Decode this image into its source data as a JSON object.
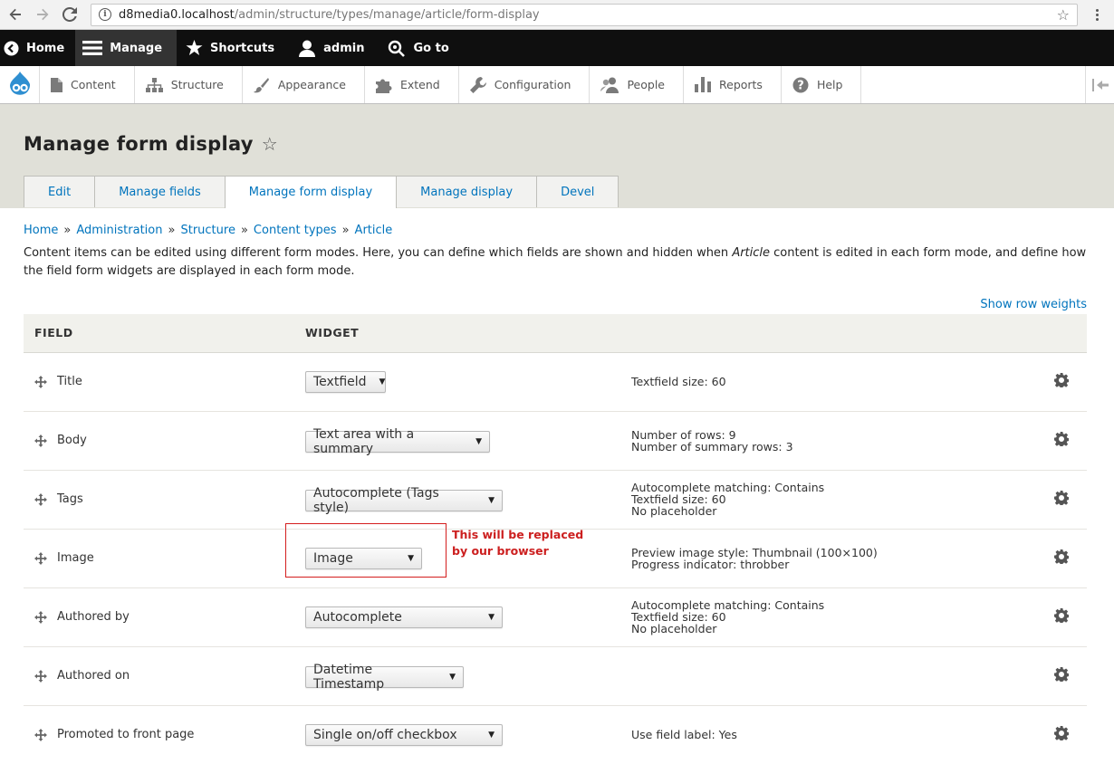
{
  "browser": {
    "url_host": "d8media0.localhost",
    "url_path": "/admin/structure/types/manage/article/form-display"
  },
  "toolbar": {
    "home": "Home",
    "manage": "Manage",
    "shortcuts": "Shortcuts",
    "user": "admin",
    "goto": "Go to"
  },
  "tray": {
    "items": [
      "Content",
      "Structure",
      "Appearance",
      "Extend",
      "Configuration",
      "People",
      "Reports",
      "Help"
    ]
  },
  "page": {
    "title": "Manage form display",
    "tabs": [
      "Edit",
      "Manage fields",
      "Manage form display",
      "Manage display",
      "Devel"
    ],
    "active_tab": "Manage form display"
  },
  "breadcrumb": [
    "Home",
    "Administration",
    "Structure",
    "Content types",
    "Article"
  ],
  "description": {
    "part1": "Content items can be edited using different form modes. Here, you can define which fields are shown and hidden when ",
    "emphasis": "Article",
    "part2": " content is edited in each form mode, and define how the field form widgets are displayed in each form mode."
  },
  "row_weights_link": "Show row weights",
  "table": {
    "headers": {
      "field": "FIELD",
      "widget": "WIDGET"
    },
    "rows": [
      {
        "field": "Title",
        "widget": "Textfield",
        "summary": [
          "Textfield size: 60"
        ]
      },
      {
        "field": "Body",
        "widget": "Text area with a summary",
        "summary": [
          "Number of rows: 9",
          "Number of summary rows: 3"
        ]
      },
      {
        "field": "Tags",
        "widget": "Autocomplete (Tags style)",
        "summary": [
          "Autocomplete matching: Contains",
          "Textfield size: 60",
          "No placeholder"
        ]
      },
      {
        "field": "Image",
        "widget": "Image",
        "summary": [
          "Preview image style: Thumbnail (100×100)",
          "Progress indicator: throbber"
        ]
      },
      {
        "field": "Authored by",
        "widget": "Autocomplete",
        "summary": [
          "Autocomplete matching: Contains",
          "Textfield size: 60",
          "No placeholder"
        ]
      },
      {
        "field": "Authored on",
        "widget": "Datetime Timestamp",
        "summary": []
      },
      {
        "field": "Promoted to front page",
        "widget": "Single on/off checkbox",
        "summary": [
          "Use field label: Yes"
        ]
      }
    ]
  },
  "annotation": {
    "line1": "This will be replaced",
    "line2": "by our browser",
    "color": "#cc1f1f"
  }
}
